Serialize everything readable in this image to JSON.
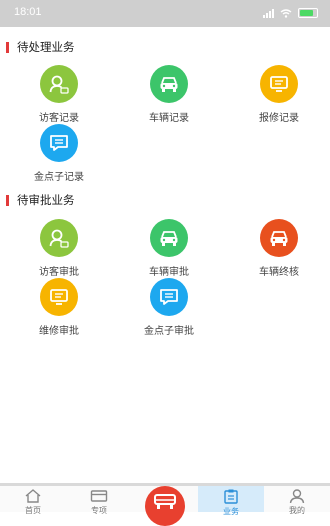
{
  "status_bar": {
    "time": "18:01"
  },
  "sections": [
    {
      "title": "待处理业务",
      "items": [
        {
          "label": "访客记录",
          "icon": "visitor-icon",
          "color": "#8cc63e"
        },
        {
          "label": "车辆记录",
          "icon": "car-icon",
          "color": "#3cc56a"
        },
        {
          "label": "报修记录",
          "icon": "monitor-icon",
          "color": "#f7b400"
        },
        {
          "label": "金点子记录",
          "icon": "chat-icon",
          "color": "#1da8ef"
        }
      ]
    },
    {
      "title": "待审批业务",
      "items": [
        {
          "label": "访客审批",
          "icon": "visitor-icon",
          "color": "#8cc63e"
        },
        {
          "label": "车辆审批",
          "icon": "car-icon",
          "color": "#3cc56a"
        },
        {
          "label": "车辆终核",
          "icon": "car-icon",
          "color": "#e8501e"
        },
        {
          "label": "维修审批",
          "icon": "monitor-icon",
          "color": "#f7b400"
        },
        {
          "label": "金点子审批",
          "icon": "chat-icon",
          "color": "#1da8ef"
        }
      ]
    }
  ],
  "tabbar": {
    "tabs": [
      {
        "label": "首页",
        "icon": "home-icon"
      },
      {
        "label": "专项",
        "icon": "card-icon"
      },
      {
        "label": "",
        "icon": "car-center-icon"
      },
      {
        "label": "业务",
        "icon": "clipboard-icon",
        "active": true
      },
      {
        "label": "我的",
        "icon": "user-icon"
      }
    ]
  }
}
